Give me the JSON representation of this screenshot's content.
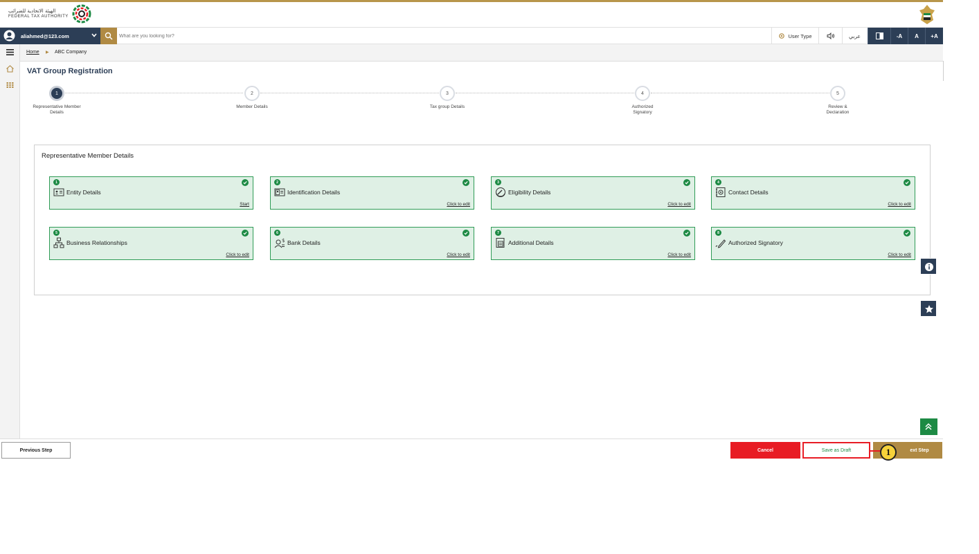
{
  "header": {
    "logo_arabic": "الهيئة الاتحادية للضرائب",
    "logo_english": "FEDERAL TAX AUTHORITY"
  },
  "toolbar": {
    "user_email": "aliahmed@123.com",
    "search_placeholder": "What are you looking for?",
    "user_type_label": "User Type",
    "language_label": "عربي",
    "font_decrease": "-A",
    "font_normal": "A",
    "font_increase": "+A"
  },
  "breadcrumb": {
    "home": "Home",
    "current": "ABC Company"
  },
  "page": {
    "title": "VAT Group Registration"
  },
  "steps": [
    {
      "number": "1",
      "label": "Representative Member Details",
      "active": true
    },
    {
      "number": "2",
      "label": "Member Details",
      "active": false
    },
    {
      "number": "3",
      "label": "Tax group Details",
      "active": false
    },
    {
      "number": "4",
      "label": "Authorized Signatory",
      "active": false
    },
    {
      "number": "5",
      "label": "Review & Declaration",
      "active": false
    }
  ],
  "panel": {
    "title": "Representative Member Details",
    "cards": [
      {
        "number": "1",
        "label": "Entity Details",
        "link": "Start",
        "icon": "id-card-icon",
        "completed": true
      },
      {
        "number": "2",
        "label": "Identification Details",
        "link": "Click to edit",
        "icon": "identification-icon",
        "completed": true
      },
      {
        "number": "3",
        "label": "Eligibility Details",
        "link": "Click to edit",
        "icon": "gauge-icon",
        "completed": true
      },
      {
        "number": "4",
        "label": "Contact Details",
        "link": "Click to edit",
        "icon": "contact-icon",
        "completed": true
      },
      {
        "number": "5",
        "label": "Business Relationships",
        "link": "Click to edit",
        "icon": "org-chart-icon",
        "completed": true
      },
      {
        "number": "6",
        "label": "Bank Details",
        "link": "Click to edit",
        "icon": "bank-user-icon",
        "completed": true
      },
      {
        "number": "7",
        "label": "Additional Details",
        "link": "Click to edit",
        "icon": "document-icon",
        "completed": true
      },
      {
        "number": "8",
        "label": "Authorized Signatory",
        "link": "Click to edit",
        "icon": "pen-icon",
        "completed": true
      }
    ]
  },
  "footer": {
    "previous": "Previous Step",
    "cancel": "Cancel",
    "save_draft": "Save as Draft",
    "next": "ext Step"
  },
  "callout": {
    "number": "1"
  },
  "colors": {
    "navy": "#2c3e56",
    "gold": "#b08a43",
    "green": "#1d8a44",
    "card_bg": "#dff0e5",
    "red": "#e81c24"
  }
}
